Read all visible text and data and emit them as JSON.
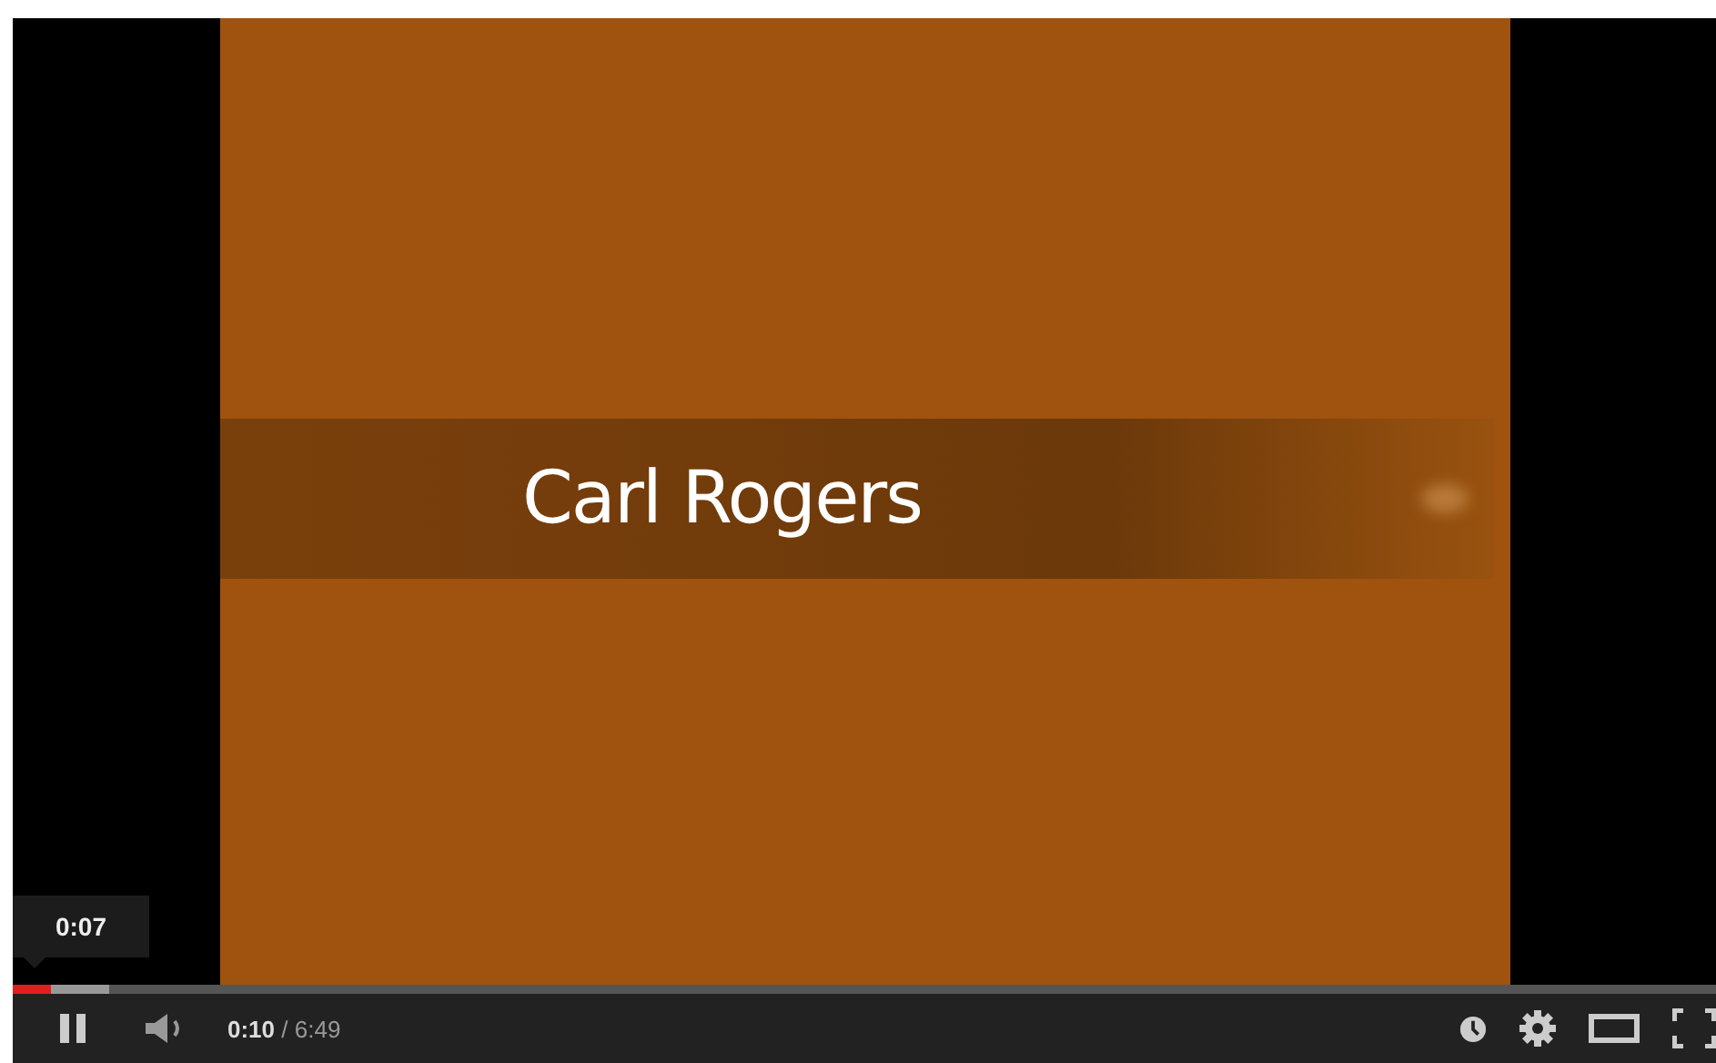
{
  "video": {
    "slide": {
      "title": "Carl Rogers"
    }
  },
  "progress": {
    "level": 0.022,
    "buffer": {
      "level": 0.057
    },
    "tooltip": "0:07"
  },
  "controls": {
    "playing": true,
    "current_time": "0:10",
    "duration": "/ 6:49"
  }
}
